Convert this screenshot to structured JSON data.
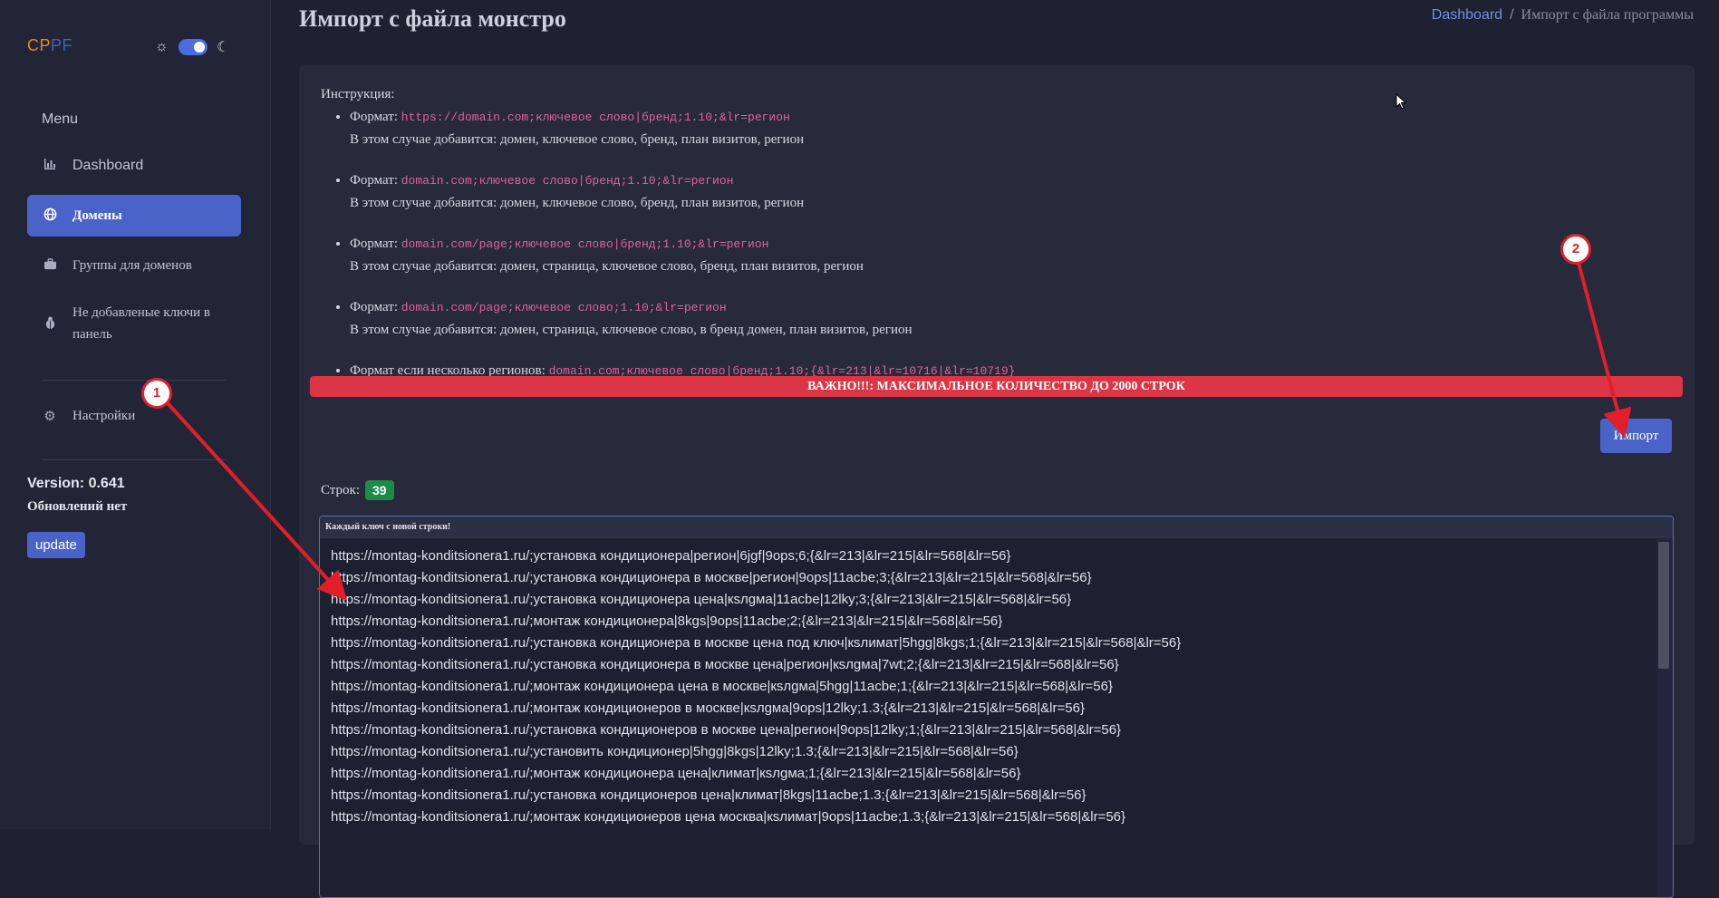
{
  "sidebar": {
    "logo": {
      "part_a": "CP",
      "part_b": "PF"
    },
    "menu_title": "Menu",
    "items": [
      {
        "label": "Dashboard",
        "icon": "chart-icon"
      },
      {
        "label": "Домены",
        "icon": "globe-icon",
        "active": true
      },
      {
        "label": "Группы для доменов",
        "icon": "briefcase-icon"
      },
      {
        "label": "Не добавленые ключи в панель",
        "icon": "bug-icon"
      },
      {
        "label": "Настройки",
        "icon": "gear-icon"
      }
    ],
    "version": "Version: 0.641",
    "updates": "Обновлений нет",
    "update_button": "update"
  },
  "header": {
    "title": "Импорт с файла монстро",
    "breadcrumb": {
      "home": "Dashboard",
      "separator": "/",
      "current": "Импорт с файла программы"
    }
  },
  "instructions": {
    "heading": "Инструкция:",
    "items": [
      {
        "prefix": "Формат:",
        "code": "https://domain.com;ключевое слово|бренд;1.10;&lr=регион",
        "note": "В этом случае добавится: домен, ключевое слово, бренд, план визитов, регион"
      },
      {
        "prefix": "Формат:",
        "code": "domain.com;ключевое слово|бренд;1.10;&lr=регион",
        "note": "В этом случае добавится: домен, ключевое слово, бренд, план визитов, регион"
      },
      {
        "prefix": "Формат:",
        "code": "domain.com/page;ключевое слово|бренд;1.10;&lr=регион",
        "note": "В этом случае добавится: домен, страница, ключевое слово, бренд, план визитов, регион"
      },
      {
        "prefix": "Формат:",
        "code": "domain.com/page;ключевое слово;1.10;&lr=регион",
        "note": "В этом случае добавится: домен, страница, ключевое слово, в бренд домен, план визитов, регион"
      },
      {
        "prefix": "Формат если несколько регионов:",
        "code": "domain.com;ключевое слово|бренд;1.10;{&lr=213|&lr=10716|&lr=10719}",
        "note": ""
      }
    ]
  },
  "important_banner": "ВАЖНО!!!: МАКСИМАЛЬНОЕ КОЛИЧЕСТВО ДО 2000 СТРОК",
  "import_button": "Импорт",
  "rows": {
    "label": "Строк:",
    "count": "39"
  },
  "textarea": {
    "label": "Каждый ключ с новой строки!",
    "lines": [
      "https://montag-konditsionera1.ru/;установка кондиционера|регион|6jgf|9ops;6;{&lr=213|&lr=215|&lr=568|&lr=56}",
      "https://montag-konditsionera1.ru/;установка кондиционера в москве|регион|9ops|11acbe;3;{&lr=213|&lr=215|&lr=568|&lr=56}",
      "https://montag-konditsionera1.ru/;установка кондиционера цена|кsлgма|11acbe|12lky;3;{&lr=213|&lr=215|&lr=568|&lr=56}",
      "https://montag-konditsionera1.ru/;монтаж кондиционера|8kgs|9ops|11acbe;2;{&lr=213|&lr=215|&lr=568|&lr=56}",
      "https://montag-konditsionera1.ru/;установка кондиционера в москве цена под ключ|кsлимат|5hgg|8kgs;1;{&lr=213|&lr=215|&lr=568|&lr=56}",
      "https://montag-konditsionera1.ru/;установка кондиционера в москве цена|регион|кsлgма|7wt;2;{&lr=213|&lr=215|&lr=568|&lr=56}",
      "https://montag-konditsionera1.ru/;монтаж кондиционера цена в москве|кsлgма|5hgg|11acbe;1;{&lr=213|&lr=215|&lr=568|&lr=56}",
      "https://montag-konditsionera1.ru/;монтаж кондиционеров в москве|кsлgма|9ops|12lky;1.3;{&lr=213|&lr=215|&lr=568|&lr=56}",
      "https://montag-konditsionera1.ru/;установка кондиционеров в москве цена|регион|9ops|12lky;1;{&lr=213|&lr=215|&lr=568|&lr=56}",
      "https://montag-konditsionera1.ru/;установить кондиционер|5hgg|8kgs|12lky;1.3;{&lr=213|&lr=215|&lr=568|&lr=56}",
      "https://montag-konditsionera1.ru/;монтаж кондиционера цена|климат|кsлgма;1;{&lr=213|&lr=215|&lr=568|&lr=56}",
      "https://montag-konditsionera1.ru/;установка кондиционеров цена|климат|8kgs|11acbe;1.3;{&lr=213|&lr=215|&lr=568|&lr=56}",
      "https://montag-konditsionera1.ru/;монтаж кондиционеров цена москва|кsлимат|9ops|11acbe;1.3;{&lr=213|&lr=215|&lr=568|&lr=56}"
    ]
  },
  "annotations": {
    "marker_1": "1",
    "marker_2": "2",
    "color": "#e11f2a"
  }
}
